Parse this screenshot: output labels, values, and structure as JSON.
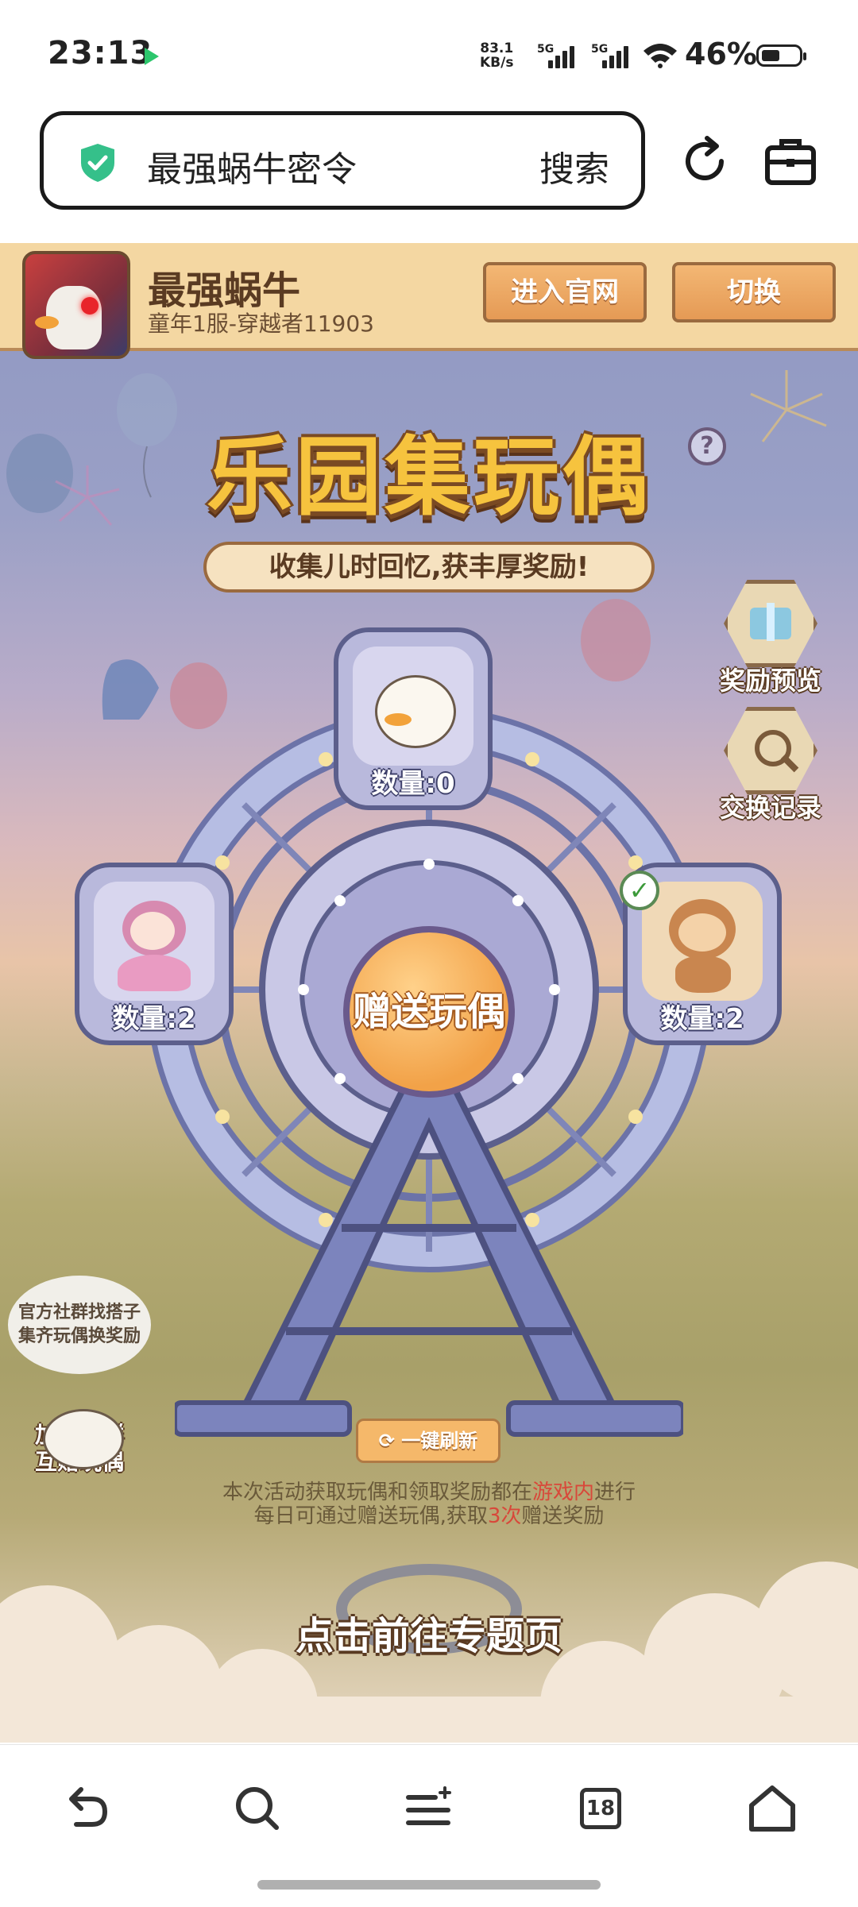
{
  "status_bar": {
    "time": "23:13",
    "net_speed_value": "83.1",
    "net_speed_unit": "KB/s",
    "signal_1_label": "5G",
    "signal_2_label": "5G",
    "battery": "46%"
  },
  "browser": {
    "search_query": "最强蜗牛密令",
    "search_button": "搜索",
    "icons": [
      "shield-check-icon",
      "refresh-icon",
      "toolbox-icon"
    ]
  },
  "game": {
    "name": "最强蜗牛",
    "server": "童年1服-穿越者11903",
    "official_site_button": "进入官网",
    "switch_button": "切换",
    "title": "乐园集玩偶",
    "subtitle": "收集儿时回忆,获丰厚奖励!",
    "help_symbol": "?",
    "reward_preview": "奖励预览",
    "exchange_record": "交换记录",
    "cabins": [
      {
        "doll": "duck",
        "count_label": "数量:0"
      },
      {
        "doll": "girl",
        "count_label": "数量:2"
      },
      {
        "doll": "monkey",
        "count_label": "数量:2"
      }
    ],
    "gift_button": "赠送玩偶",
    "social_bubble_line1": "官方社群找搭子",
    "social_bubble_line2": "集齐玩偶换奖励",
    "social_join_line1": "加入社群",
    "social_join_line2": "互赠玩偶",
    "refresh_button": "一键刷新",
    "note1_pre": "本次活动获取玩偶和领取奖励都在",
    "note1_hl": "游戏内",
    "note1_post": "进行",
    "note2_pre": "每日可通过赠送玩偶,获取",
    "note2_hl": "3次",
    "note2_post": "赠送奖励",
    "topic_button": "点击前往专题页"
  },
  "bottom_nav": {
    "icons": [
      "back-icon",
      "search-icon",
      "menu-icon",
      "tabs-icon",
      "home-icon"
    ],
    "tabs_count": "18"
  }
}
